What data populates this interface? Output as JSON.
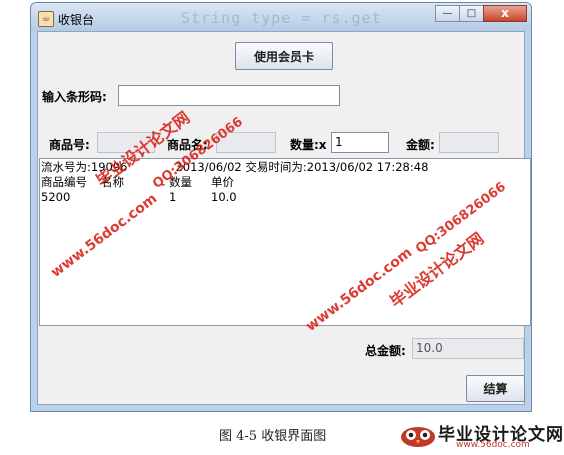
{
  "window": {
    "title": "收银台",
    "title_ghost_text": "String type = rs.get",
    "minimize": "—",
    "maximize": "□",
    "close": "x"
  },
  "member_button": "使用会员卡",
  "barcode": {
    "label": "输入条形码:",
    "value": ""
  },
  "product_row": {
    "product_no_label": "商品号:",
    "product_no_value": "",
    "product_name_label": "商品名:",
    "product_name_value": "",
    "quantity_label": "数量:x",
    "quantity_value": "1",
    "amount_label": "金额:",
    "amount_value": ""
  },
  "receipt": {
    "line1": "流水号为:19096",
    "line1_mid": "2013/06/02",
    "line1_tail": "交易时间为:2013/06/02 17:28:48",
    "headers": [
      "商品编号",
      "名称",
      "数量",
      "单价"
    ],
    "rows": [
      [
        "5200",
        "",
        "1",
        "10.0"
      ]
    ]
  },
  "total": {
    "label": "总金额:",
    "value": "10.0"
  },
  "checkout_button": "结算",
  "watermarks": {
    "site_name": "毕业设计论文网",
    "qq": "QQ:306826066",
    "url": "www.56doc.com"
  },
  "caption": "图 4-5 收银界面图",
  "footer_logo": {
    "name": "毕业设计论文网",
    "url": "www.56doc.com"
  },
  "colors": {
    "window_frame": "#b9d1ea",
    "watermark": "#d9281f",
    "close_button": "#c8452b"
  }
}
